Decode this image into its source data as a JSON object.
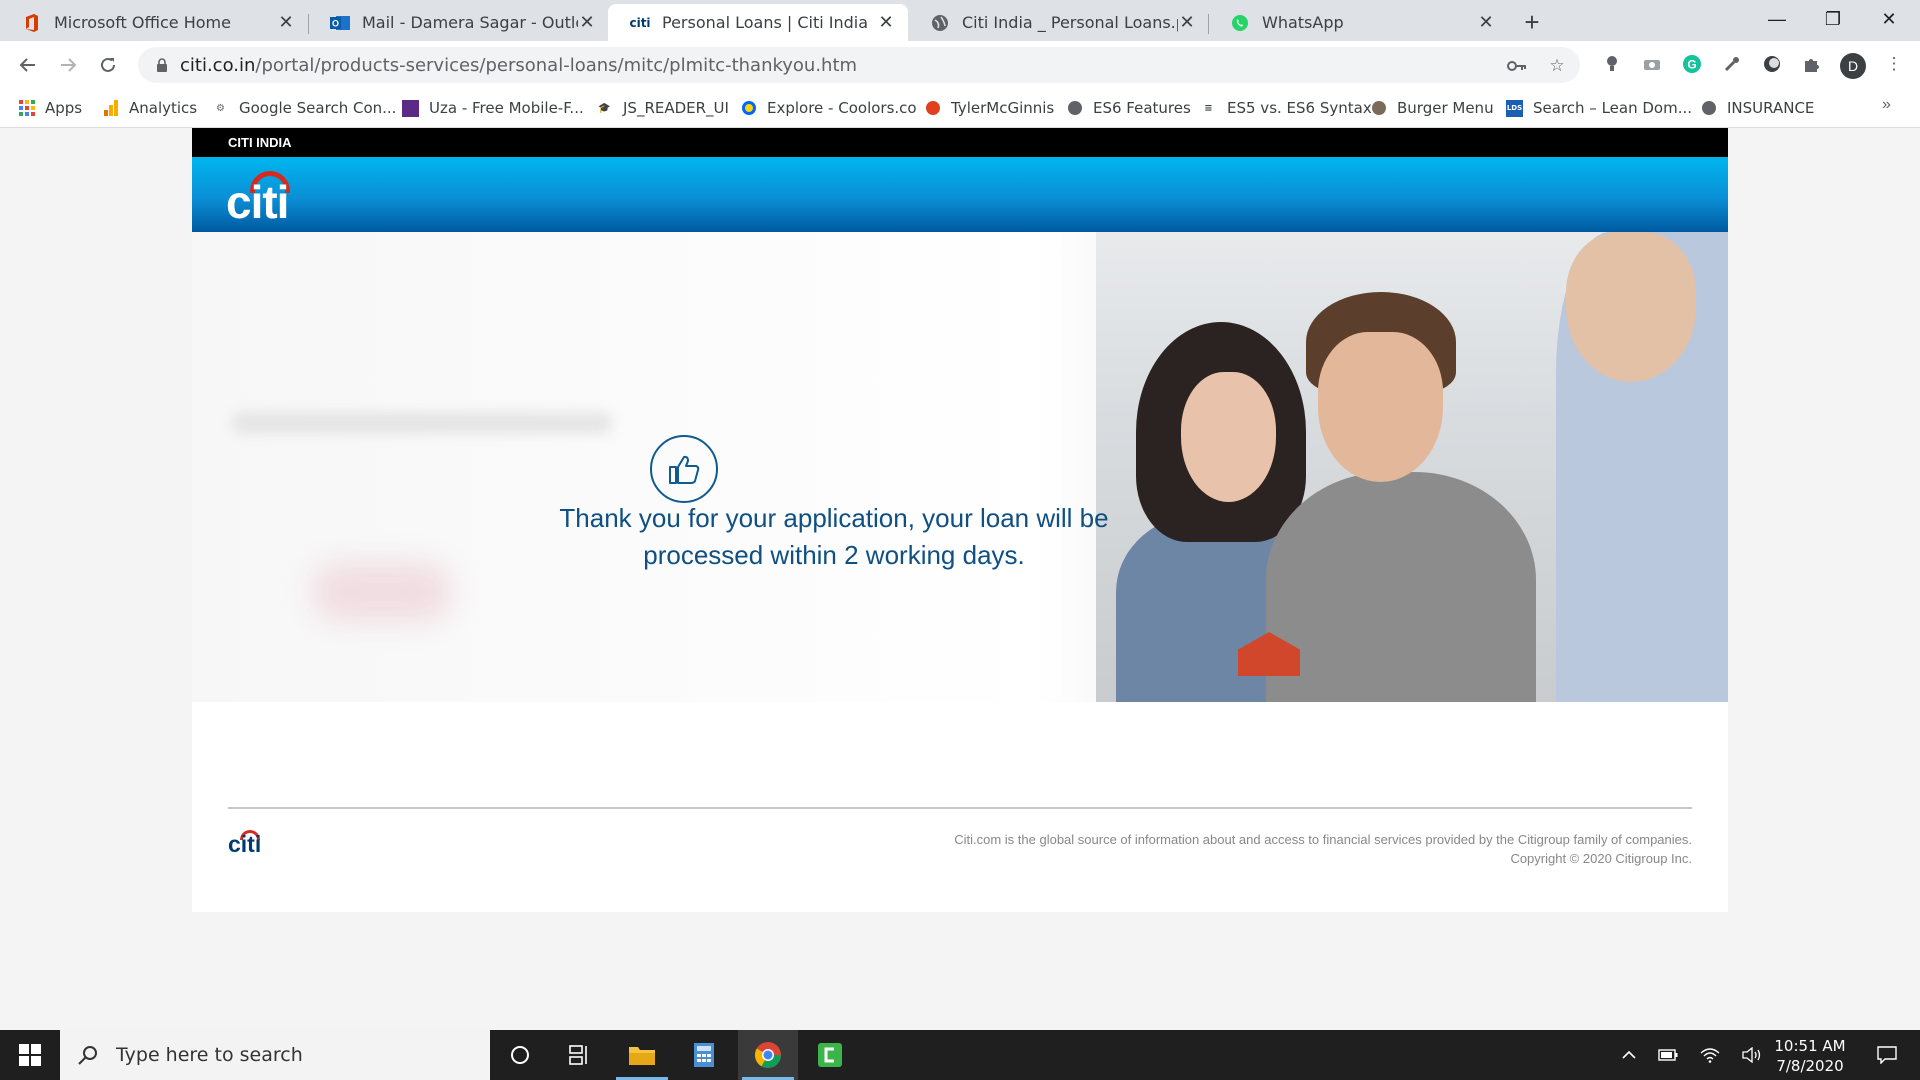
{
  "browser": {
    "tabs": [
      {
        "title": "Microsoft Office Home",
        "active": false
      },
      {
        "title": "Mail - Damera Sagar - Outlook",
        "active": false
      },
      {
        "title": "Personal Loans | Citi India",
        "active": true
      },
      {
        "title": "Citi India _ Personal Loans.pdf",
        "active": false
      },
      {
        "title": "WhatsApp",
        "active": false
      }
    ],
    "url_host": "citi.co.in",
    "url_path": "/portal/products-services/personal-loans/mitc/plmitc-thankyou.htm",
    "profile_initial": "D",
    "bookmarks": [
      "Apps",
      "Analytics",
      "Google Search Con...",
      "Uza - Free Mobile-F...",
      "JS_READER_UI",
      "Explore - Coolors.co",
      "TylerMcGinnis",
      "ES6 Features",
      "ES5 vs. ES6 Syntax",
      "Burger Menu",
      "Search – Lean Dom...",
      "INSURANCE"
    ]
  },
  "page": {
    "topbar_label": "CITI INDIA",
    "logo_text": "citi",
    "thankyou_message": "Thank you for your application, your loan will be processed within 2 working days.",
    "footer_logo_text": "citi",
    "footer_line1": "Citi.com is the global source of information about and access to financial services provided by the Citigroup family of companies.",
    "footer_line2": "Copyright © 2020 Citigroup Inc.",
    "colors": {
      "header_gradient_top": "#00b6ef",
      "header_gradient_bottom": "#005aa0",
      "message_text": "#0f4f82",
      "citi_red": "#d52b1e"
    }
  },
  "taskbar": {
    "search_placeholder": "Type here to search",
    "time": "10:51 AM",
    "date": "7/8/2020"
  }
}
